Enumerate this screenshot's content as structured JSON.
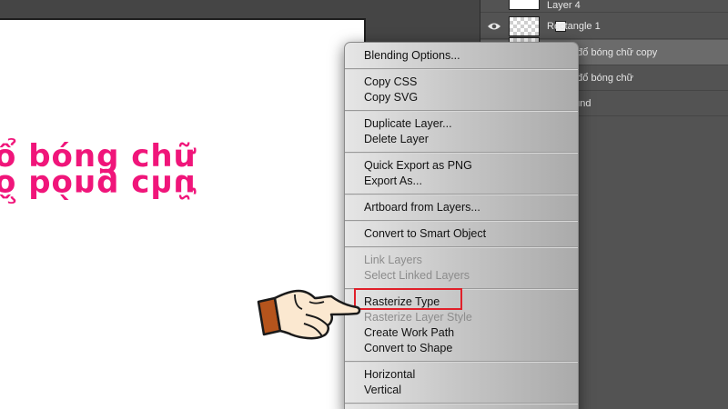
{
  "canvas": {
    "text_line": "ổ bóng chữ",
    "text_color": "#f0157a"
  },
  "layers": {
    "items": [
      {
        "name": "Layer 4",
        "thumb": "white",
        "visible": false
      },
      {
        "name": "Rectangle 1",
        "thumb": "checker",
        "visible": true
      },
      {
        "name": "o đổ bóng chữ copy",
        "thumb": "checker",
        "visible": false,
        "selected": true
      },
      {
        "name": "o đổ bóng chữ",
        "thumb": "none",
        "visible": false
      },
      {
        "name": "ound",
        "thumb": "none",
        "visible": false
      }
    ]
  },
  "context_menu": {
    "items": [
      {
        "label": "Blending Options...",
        "enabled": true
      },
      {
        "label": "Copy CSS",
        "enabled": true
      },
      {
        "label": "Copy SVG",
        "enabled": true
      },
      {
        "label": "Duplicate Layer...",
        "enabled": true
      },
      {
        "label": "Delete Layer",
        "enabled": true
      },
      {
        "label": "Quick Export as PNG",
        "enabled": true
      },
      {
        "label": "Export As...",
        "enabled": true
      },
      {
        "label": "Artboard from Layers...",
        "enabled": true
      },
      {
        "label": "Convert to Smart Object",
        "enabled": true
      },
      {
        "label": "Link Layers",
        "enabled": false
      },
      {
        "label": "Select Linked Layers",
        "enabled": false
      },
      {
        "label": "Rasterize Type",
        "enabled": true,
        "highlighted": true
      },
      {
        "label": "Rasterize Layer Style",
        "enabled": false
      },
      {
        "label": "Create Work Path",
        "enabled": true
      },
      {
        "label": "Convert to Shape",
        "enabled": true
      },
      {
        "label": "Horizontal",
        "enabled": true
      },
      {
        "label": "Vertical",
        "enabled": true
      }
    ],
    "highlight_color": "#e0202a"
  },
  "icons": {
    "eye": "eye-icon",
    "pointer": "pointing-hand-icon"
  }
}
